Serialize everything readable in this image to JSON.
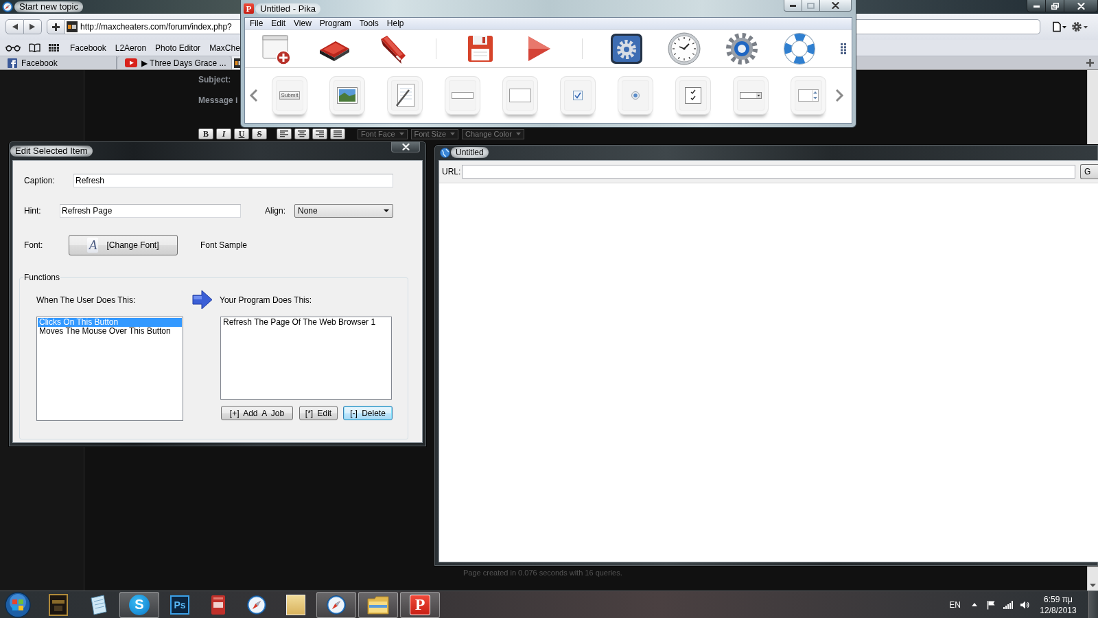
{
  "browser": {
    "title": "Start new topic",
    "url": "http://maxcheaters.com/forum/index.php?",
    "bookmarks": [
      "Facebook",
      "L2Aeron",
      "Photo Editor",
      "MaxChe"
    ],
    "tabs": [
      {
        "kind": "facebook",
        "title": "Facebook",
        "selected": false
      },
      {
        "kind": "youtube",
        "title": "▶ Three Days Grace ...",
        "selected": false
      },
      {
        "kind": "site",
        "selected": true
      }
    ],
    "page": {
      "subject_label": "Subject:",
      "message_label": "Message i",
      "editor_buttons": [
        {
          "kind": "bold",
          "label": "B"
        },
        {
          "kind": "italic",
          "label": "I"
        },
        {
          "kind": "underline",
          "label": "U"
        },
        {
          "kind": "strike",
          "label": "S"
        },
        {
          "kind": "align_left"
        },
        {
          "kind": "align_center"
        },
        {
          "kind": "align_right"
        },
        {
          "kind": "justify"
        }
      ],
      "dropdowns": [
        "Font Face",
        "Font Size",
        "Change Color"
      ],
      "footer": "Page created in 0.076 seconds with 16 queries."
    }
  },
  "pika": {
    "title": "Untitled - Pika",
    "logo": "P",
    "menu": [
      "File",
      "Edit",
      "View",
      "Program",
      "Tools",
      "Help"
    ],
    "toolbar": [
      {
        "kind": "new"
      },
      {
        "kind": "open"
      },
      {
        "kind": "tool"
      },
      {
        "kind": "separator"
      },
      {
        "kind": "save"
      },
      {
        "kind": "run"
      },
      {
        "kind": "separator"
      },
      {
        "kind": "settings"
      },
      {
        "kind": "clock"
      },
      {
        "kind": "options"
      },
      {
        "kind": "help"
      },
      {
        "kind": "more"
      }
    ],
    "components": [
      {
        "kind": "button",
        "label": "Submit"
      },
      {
        "kind": "picture"
      },
      {
        "kind": "notepad"
      },
      {
        "kind": "textbox"
      },
      {
        "kind": "panel"
      },
      {
        "kind": "checkbox"
      },
      {
        "kind": "radio"
      },
      {
        "kind": "checklist"
      },
      {
        "kind": "dropdown"
      },
      {
        "kind": "spinner"
      }
    ]
  },
  "edit_dialog": {
    "title": "Edit Selected Item",
    "caption": {
      "label": "Caption:",
      "value": "Refresh"
    },
    "hint": {
      "label": "Hint:",
      "value": "Refresh Page"
    },
    "align": {
      "label": "Align:",
      "value": "None"
    },
    "font": {
      "label": "Font:",
      "icon_glyph": "A",
      "button": "[Change Font]",
      "sample": "Font Sample"
    },
    "functions": {
      "title": "Functions",
      "events_heading": "When The User Does This:",
      "jobs_heading": "Your Program Does This:",
      "events": [
        {
          "text": "Clicks On This Button",
          "selected": true
        },
        {
          "text": "Moves The Mouse Over This Button",
          "selected": false
        }
      ],
      "jobs": [
        {
          "text": "Refresh The Page Of The Web Browser 1",
          "selected": false
        }
      ],
      "buttons": [
        {
          "label": "[+] Add A Job",
          "focused": false
        },
        {
          "label": "[*] Edit",
          "focused": false
        },
        {
          "label": "[-] Delete",
          "focused": true
        }
      ]
    }
  },
  "web_window": {
    "title": "Untitled",
    "url_label": "URL:",
    "go_button": "G"
  },
  "taskbar": {
    "buttons": [
      {
        "kind": "game",
        "running": false
      },
      {
        "kind": "notepad",
        "running": false
      },
      {
        "kind": "round_glyph",
        "glyph": "S",
        "running": true
      },
      {
        "kind": "square_glyph",
        "glyph": "Ps",
        "running": false
      },
      {
        "kind": "document",
        "running": false
      },
      {
        "kind": "compass",
        "running": false
      },
      {
        "kind": "photo",
        "running": false
      },
      {
        "kind": "compass",
        "running": true
      },
      {
        "kind": "folder",
        "running": true
      },
      {
        "kind": "tile_glyph",
        "glyph": "P",
        "running": true
      }
    ],
    "tray": {
      "language": "EN",
      "time": "6:59 πμ",
      "date": "12/8/2013"
    }
  }
}
